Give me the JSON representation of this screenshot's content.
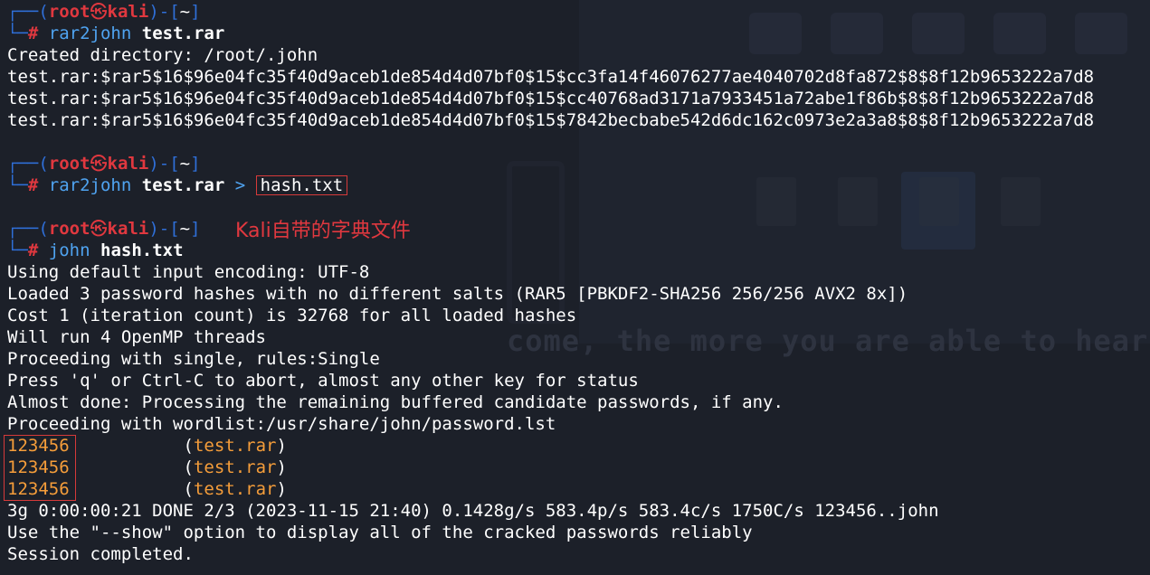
{
  "prompt": {
    "user": "root",
    "skull": "㉿",
    "host": "kali",
    "dir": "~",
    "hash": "#"
  },
  "block1": {
    "command": "rar2john",
    "arg": "test.rar",
    "created": "Created directory: /root/.john",
    "hashes": [
      "test.rar:$rar5$16$96e04fc35f40d9aceb1de854d4d07bf0$15$cc3fa14f46076277ae4040702d8fa872$8$8f12b9653222a7d8",
      "test.rar:$rar5$16$96e04fc35f40d9aceb1de854d4d07bf0$15$cc40768ad3171a7933451a72abe1f86b$8$8f12b9653222a7d8",
      "test.rar:$rar5$16$96e04fc35f40d9aceb1de854d4d07bf0$15$7842becbabe542d6dc162c0973e2a3a8$8$8f12b9653222a7d8"
    ]
  },
  "block2": {
    "command": "rar2john",
    "arg": "test.rar",
    "redirect": ">",
    "target": "hash.txt"
  },
  "block3": {
    "command": "john",
    "arg": "hash.txt",
    "annotation": "Kali自带的字典文件",
    "output": [
      "Using default input encoding: UTF-8",
      "Loaded 3 password hashes with no different salts (RAR5 [PBKDF2-SHA256 256/256 AVX2 8x])",
      "Cost 1 (iteration count) is 32768 for all loaded hashes",
      "Will run 4 OpenMP threads",
      "Proceeding with single, rules:Single",
      "Press 'q' or Ctrl-C to abort, almost any other key for status",
      "Almost done: Processing the remaining buffered candidate passwords, if any.",
      "Proceeding with wordlist:/usr/share/john/password.lst"
    ],
    "cracked": [
      {
        "password": "123456",
        "file": "test.rar"
      },
      {
        "password": "123456",
        "file": "test.rar"
      },
      {
        "password": "123456",
        "file": "test.rar"
      }
    ],
    "summary": "3g 0:00:00:21 DONE 2/3 (2023-11-15 21:40) 0.1428g/s 583.4p/s 583.4c/s 1750C/s 123456..john",
    "show_hint": "Use the \"--show\" option to display all of the cracked passwords reliably",
    "done": "Session completed."
  },
  "background": {
    "big_text": "come, the more you are able to hear"
  },
  "colors": {
    "background": "#1c2029",
    "prompt_red": "#e0383f",
    "prompt_blue": "#2f6fd8",
    "command_blue": "#4fa3f0",
    "password_orange": "#f59d3a"
  }
}
